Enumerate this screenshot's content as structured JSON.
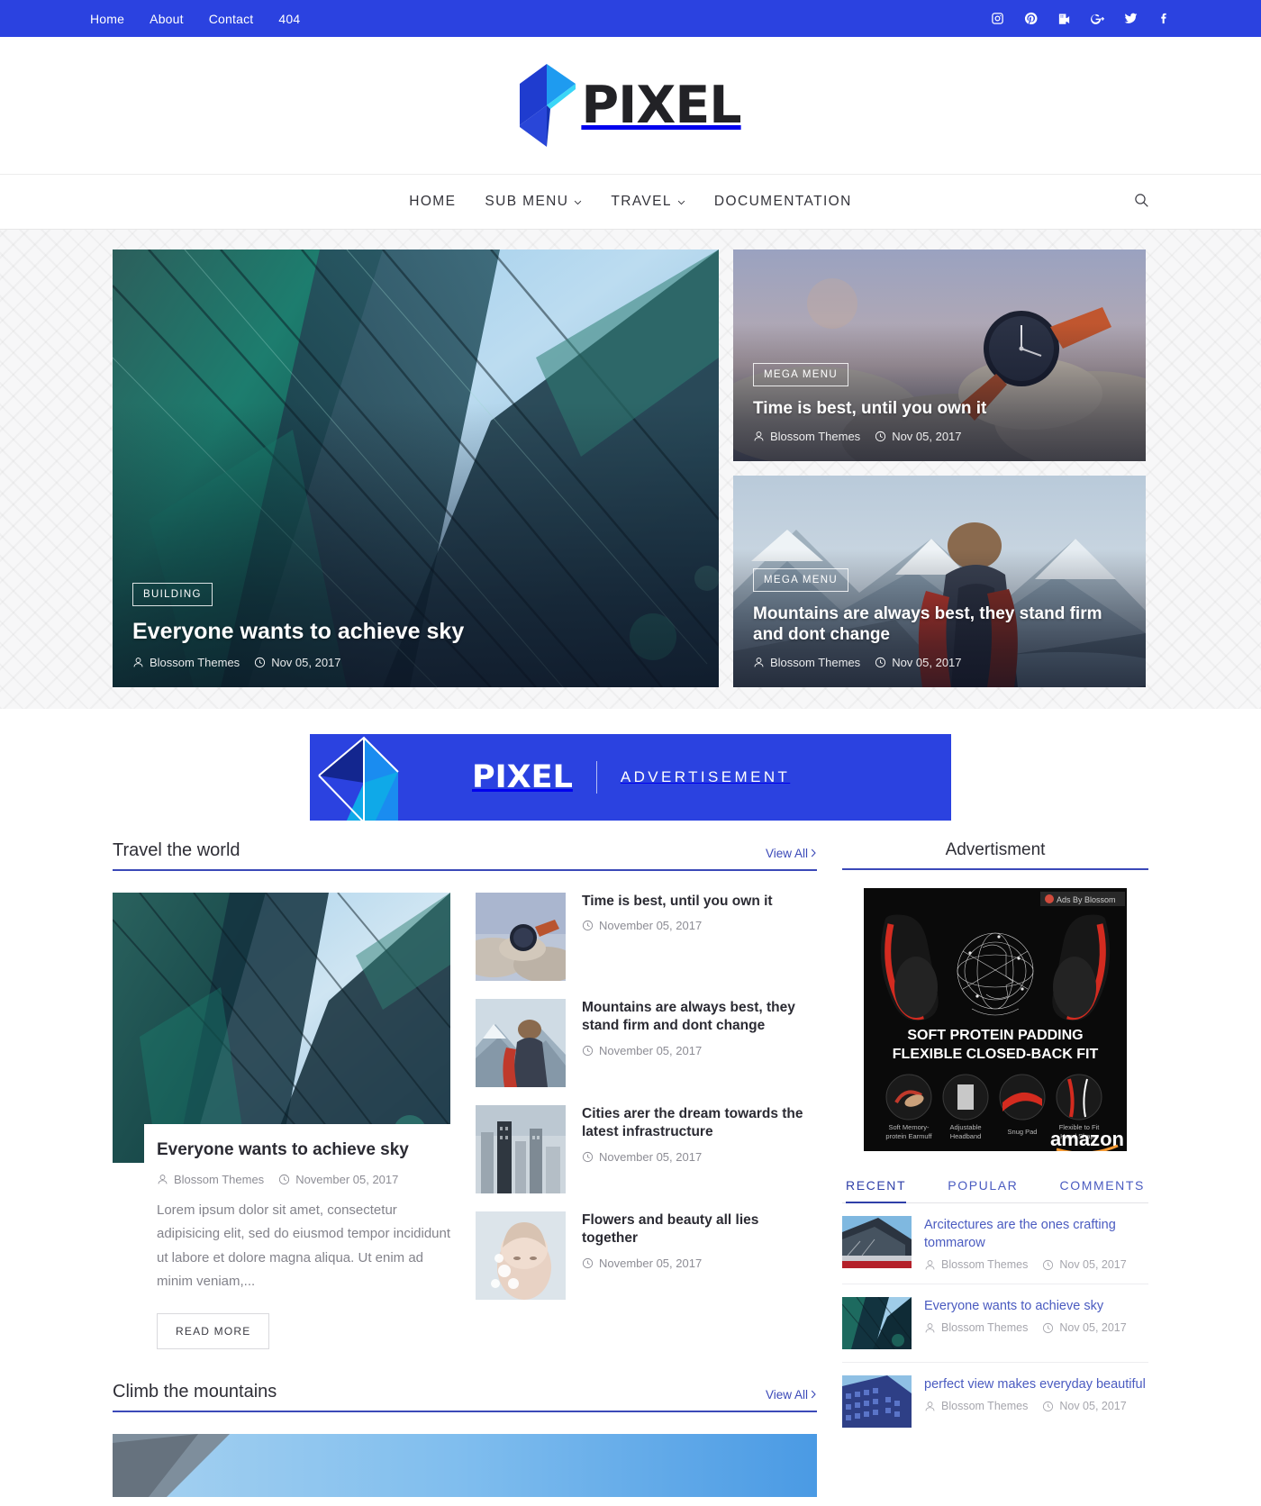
{
  "topbar": {
    "nav": [
      {
        "label": "Home",
        "name": "topnav-home"
      },
      {
        "label": "About",
        "name": "topnav-about"
      },
      {
        "label": "Contact",
        "name": "topnav-contact"
      },
      {
        "label": "404",
        "name": "topnav-404"
      }
    ],
    "social": [
      "instagram-icon",
      "pinterest-icon",
      "youtube-icon",
      "google-plus-icon",
      "twitter-icon",
      "facebook-icon"
    ],
    "bg": "#2b42e0"
  },
  "brand": {
    "name": "PIXEL",
    "logo_icon": "pixel-logo-icon"
  },
  "mainnav": {
    "items": [
      {
        "label": "HOME",
        "dropdown": false
      },
      {
        "label": "SUB MENU",
        "dropdown": true
      },
      {
        "label": "TRAVEL",
        "dropdown": true
      },
      {
        "label": "DOCUMENTATION",
        "dropdown": false
      }
    ],
    "search_icon": "search-icon"
  },
  "hero": {
    "main": {
      "category": "BUILDING",
      "title": "Everyone wants to achieve sky",
      "author": "Blossom Themes",
      "date": "Nov 05, 2017"
    },
    "side": [
      {
        "category": "MEGA MENU",
        "title": "Time is best, until you own it",
        "author": "Blossom Themes",
        "date": "Nov 05, 2017"
      },
      {
        "category": "MEGA MENU",
        "title": "Mountains are always best, they stand firm and dont change",
        "author": "Blossom Themes",
        "date": "Nov 05, 2017"
      }
    ]
  },
  "ad_banner": {
    "brand": "PIXEL",
    "label": "ADVERTISEMENT",
    "bg": "#2b42e0"
  },
  "travel": {
    "section_title": "Travel the world",
    "view_all": "View All",
    "feature": {
      "title": "Everyone wants to achieve sky",
      "author": "Blossom Themes",
      "date": "November 05, 2017",
      "excerpt": "Lorem ipsum dolor sit amet, consectetur adipisicing elit, sed do eiusmod tempor incididunt ut labore et dolore magna aliqua. Ut enim ad minim veniam,...",
      "read_more": "READ MORE"
    },
    "list": [
      {
        "title": "Time is best, until you own it",
        "date": "November 05, 2017"
      },
      {
        "title": "Mountains are always best, they stand firm and dont change",
        "date": "November 05, 2017"
      },
      {
        "title": "Cities arer the dream towards the latest infrastructure",
        "date": "November 05, 2017"
      },
      {
        "title": "Flowers and beauty all lies together",
        "date": "November 05, 2017"
      }
    ]
  },
  "sidebar": {
    "ad_title": "Advertisment",
    "ad": {
      "badge": "Ads By Blossom",
      "headline_line1": "SOFT PROTEIN PADDING",
      "headline_line2": "FLEXIBLE CLOSED-BACK FIT",
      "features": [
        "Soft Memory-protein Earmuff",
        "Adjustable Headband",
        "Snug Pad",
        "Flexible to Fit Head Shape"
      ],
      "store": "amazon"
    },
    "tabs": [
      {
        "label": "RECENT",
        "active": true
      },
      {
        "label": "POPULAR",
        "active": false
      },
      {
        "label": "COMMENTS",
        "active": false
      }
    ],
    "posts": [
      {
        "title": "Arcitectures are the ones crafting tommarow",
        "author": "Blossom Themes",
        "date": "Nov 05, 2017"
      },
      {
        "title": "Everyone wants to achieve sky",
        "author": "Blossom Themes",
        "date": "Nov 05, 2017"
      },
      {
        "title": "perfect view makes everyday beautiful",
        "author": "Blossom Themes",
        "date": "Nov 05, 2017"
      }
    ]
  },
  "mountains": {
    "section_title": "Climb the mountains",
    "view_all": "View All"
  },
  "colors": {
    "accent": "#2b42e0",
    "link": "#3b49b8",
    "text": "#2b2b33",
    "muted": "#8d8d95"
  }
}
